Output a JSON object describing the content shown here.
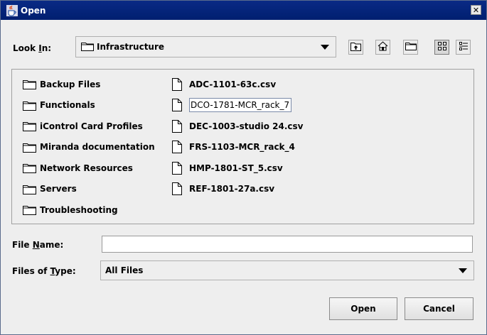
{
  "window": {
    "title": "Open",
    "close_label": "✕"
  },
  "look_in": {
    "label_prefix": "Look ",
    "label_mnemonic": "I",
    "label_suffix": "n:",
    "value": "Infrastructure"
  },
  "toolbar": {
    "icons": [
      "up-one-level-icon",
      "home-icon",
      "new-folder-icon",
      "list-view-icon",
      "details-view-icon"
    ],
    "active": "list-view-icon"
  },
  "files": {
    "folders": [
      "Backup Files",
      "Functionals",
      "iControl Card Profiles",
      "Miranda documentation",
      "Network Resources",
      "Servers",
      "Troubleshooting"
    ],
    "documents": [
      "ADC-1101-63c.csv",
      "DCO-1781-MCR_rack_7",
      "DEC-1003-studio 24.csv",
      "FRS-1103-MCR_rack_4",
      "HMP-1801-ST_5.csv",
      "REF-1801-27a.csv"
    ],
    "selected_index": 1
  },
  "file_name": {
    "label_prefix": "File ",
    "label_mnemonic": "N",
    "label_suffix": "ame:",
    "value": "",
    "placeholder": ""
  },
  "file_type": {
    "label_prefix": "Files of ",
    "label_mnemonic": "T",
    "label_suffix": "ype:",
    "value": "All Files"
  },
  "buttons": {
    "open": "Open",
    "cancel": "Cancel"
  }
}
